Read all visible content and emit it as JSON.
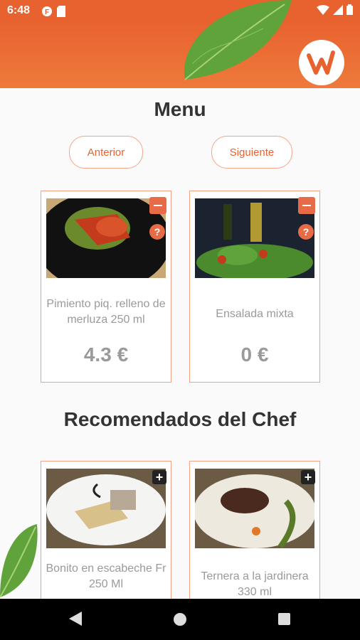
{
  "status_bar": {
    "time": "6:48"
  },
  "header": {
    "logo": "app-logo"
  },
  "menu": {
    "title": "Menu",
    "prev_label": "Anterior",
    "next_label": "Siguiente",
    "items": [
      {
        "name": "Pimiento piq. relleno de merluza 250 ml",
        "price": "4.3 €"
      },
      {
        "name": "Ensalada mixta",
        "price": "0 €"
      }
    ]
  },
  "chef": {
    "title": "Recomendados del Chef",
    "items": [
      {
        "name": "Bonito en escabeche Fr 250 Ml"
      },
      {
        "name": "Ternera a la jardinera 330 ml"
      }
    ]
  },
  "colors": {
    "accent": "#e8622f",
    "border": "#f4a184",
    "text_muted": "#9a9a9a"
  }
}
